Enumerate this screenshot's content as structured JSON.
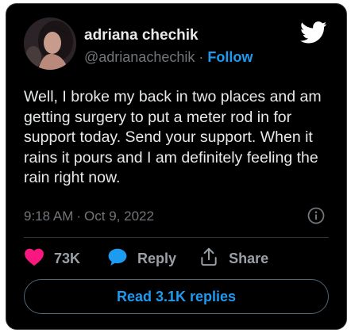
{
  "colors": {
    "background": "#000000",
    "text": "#e7e9ea",
    "muted": "#71767b",
    "accent": "#1d9bf0",
    "like": "#f91880"
  },
  "author": {
    "name": "adriana chechik",
    "handle": "@adrianachechik",
    "separator": "·",
    "follow_label": "Follow",
    "avatar_icon": "avatar-photo"
  },
  "brand": {
    "icon": "twitter-bird-icon"
  },
  "tweet": {
    "text": "Well, I broke my back in two places and am getting surgery to put a meter rod in for support today. Send your support. When it rains it pours and I am definitely feeling the rain right now.",
    "time": "9:18 AM",
    "separator": "·",
    "date": "Oct 9, 2022",
    "info_icon": "info-icon"
  },
  "actions": {
    "like": {
      "icon": "heart-icon",
      "count": "73K"
    },
    "reply": {
      "icon": "reply-bubble-icon",
      "label": "Reply"
    },
    "share": {
      "icon": "share-icon",
      "label": "Share"
    }
  },
  "replies_button": {
    "label": "Read 3.1K replies"
  }
}
